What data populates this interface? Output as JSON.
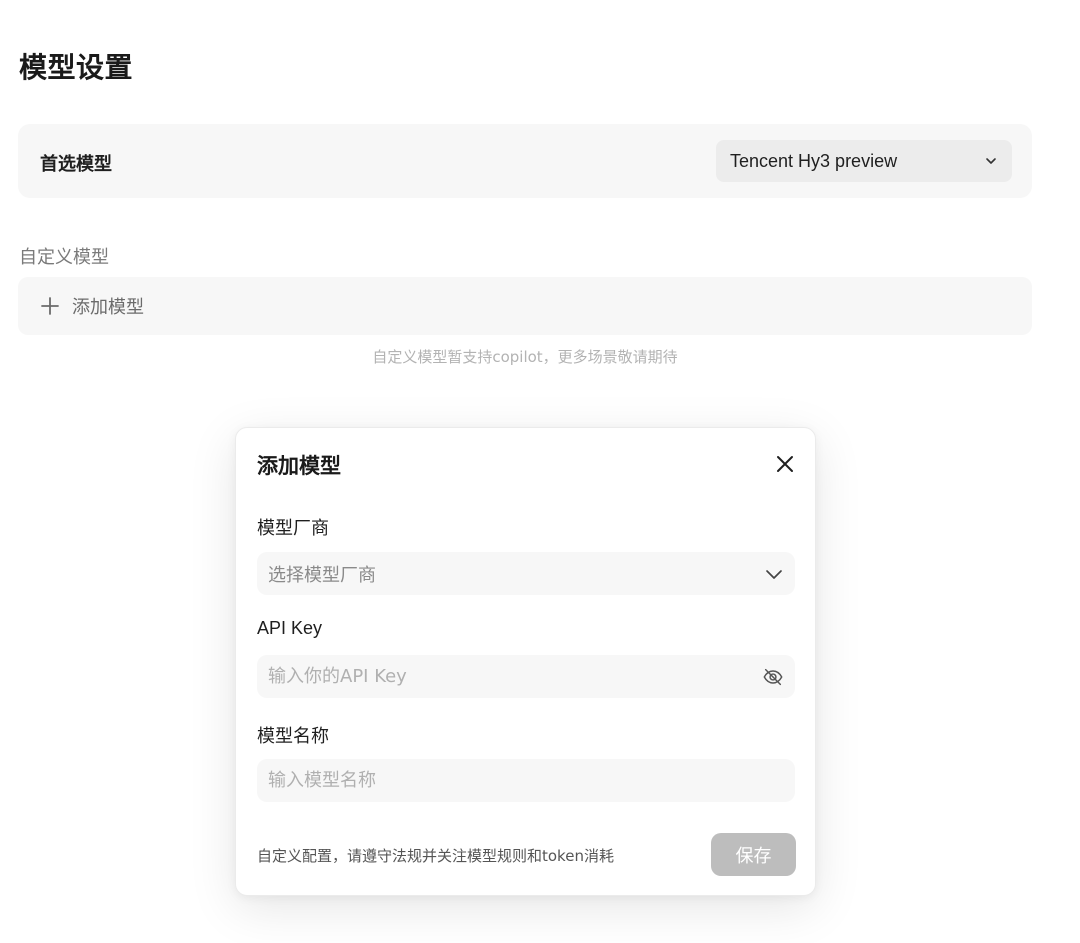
{
  "page": {
    "title": "模型设置"
  },
  "preferred_model": {
    "label": "首选模型",
    "selected_value": "Tencent Hy3 preview"
  },
  "custom_models": {
    "section_label": "自定义模型",
    "add_label": "添加模型",
    "hint": "自定义模型暂支持copilot，更多场景敬请期待"
  },
  "dialog": {
    "title": "添加模型",
    "vendor": {
      "label": "模型厂商",
      "placeholder": "选择模型厂商"
    },
    "api_key": {
      "label": "API Key",
      "placeholder": "输入你的API Key",
      "value": ""
    },
    "model_name": {
      "label": "模型名称",
      "placeholder": "输入模型名称",
      "value": ""
    },
    "footer_note": "自定义配置，请遵守法规并关注模型规则和token消耗",
    "save_label": "保存"
  },
  "icons": {
    "preferred_dropdown": "chevron-down-icon",
    "add": "plus-icon",
    "close": "close-icon",
    "vendor_dropdown": "chevron-down-icon",
    "api_key_visibility": "eye-off-icon"
  },
  "colors": {
    "card_background": "#f7f7f7",
    "save_button_disabled": "#bdbdbd",
    "hint_text": "#b3b3b3"
  }
}
